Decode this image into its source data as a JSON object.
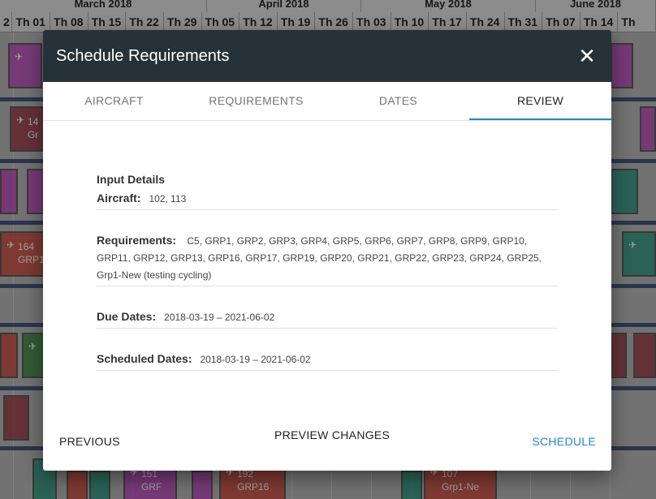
{
  "background": {
    "months": [
      "March 2018",
      "April 2018",
      "May 2018",
      "June 2018"
    ],
    "weeks": [
      "2",
      "Th 01",
      "Th 08",
      "Th 15",
      "Th 22",
      "Th 29",
      "Th 05",
      "Th 12",
      "Th 19",
      "Th 26",
      "Th 03",
      "Th 10",
      "Th 17",
      "Th 24",
      "Th 31",
      "Th 07",
      "Th 14",
      "Th"
    ],
    "blocks": [
      {
        "color": "mag",
        "t1": "",
        "t2": ""
      },
      {
        "color": "dred",
        "t1": "14",
        "t2": "Gr"
      },
      {
        "color": "mag",
        "t1": "",
        "t2": ""
      },
      {
        "color": "mag",
        "t1": "",
        "t2": ""
      },
      {
        "color": "red",
        "t1": "164",
        "t2": "GRP1"
      },
      {
        "color": "red",
        "t1": "",
        "t2": ""
      },
      {
        "color": "grn",
        "t1": "",
        "t2": ""
      },
      {
        "color": "dred",
        "t1": "",
        "t2": ""
      },
      {
        "color": "mag",
        "t1": "151",
        "t2": "GRF"
      },
      {
        "color": "red",
        "t1": "192",
        "t2": "GRP16"
      },
      {
        "color": "red",
        "t1": "107",
        "t2": "Grp1-Ne"
      },
      {
        "color": "mag",
        "t1": "",
        "t2": ""
      },
      {
        "color": "teal",
        "t1": "",
        "t2": ""
      },
      {
        "color": "teal",
        "t1": "",
        "t2": ""
      },
      {
        "color": "dred",
        "t1": "",
        "t2": ""
      },
      {
        "color": "mag",
        "t1": "",
        "t2": ""
      }
    ]
  },
  "dialog": {
    "title": "Schedule Requirements",
    "tabs": [
      {
        "label": "AIRCRAFT",
        "active": false
      },
      {
        "label": "REQUIREMENTS",
        "active": false
      },
      {
        "label": "DATES",
        "active": false
      },
      {
        "label": "REVIEW",
        "active": true
      }
    ],
    "section_title": "Input Details",
    "fields": {
      "aircraft": {
        "label": "Aircraft:",
        "value": "102, 113"
      },
      "requirements": {
        "label": "Requirements:",
        "value": "C5, GRP1, GRP2, GRP3, GRP4, GRP5, GRP6, GRP7, GRP8, GRP9, GRP10, GRP11, GRP12, GRP13, GRP16, GRP17, GRP19, GRP20, GRP21, GRP22, GRP23, GRP24, GRP25, Grp1-New (testing cycling)"
      },
      "due_dates": {
        "label": "Due Dates:",
        "value": "2018-03-19 – 2021-06-02"
      },
      "scheduled_dates": {
        "label": "Scheduled Dates:",
        "value": "2018-03-19 – 2021-06-02"
      }
    },
    "buttons": {
      "previous": "PREVIOUS",
      "preview": "PREVIEW CHANGES",
      "schedule": "SCHEDULE"
    },
    "colors": {
      "header": "#263238",
      "accent": "#1e88c8"
    },
    "close_icon": "close-icon"
  }
}
